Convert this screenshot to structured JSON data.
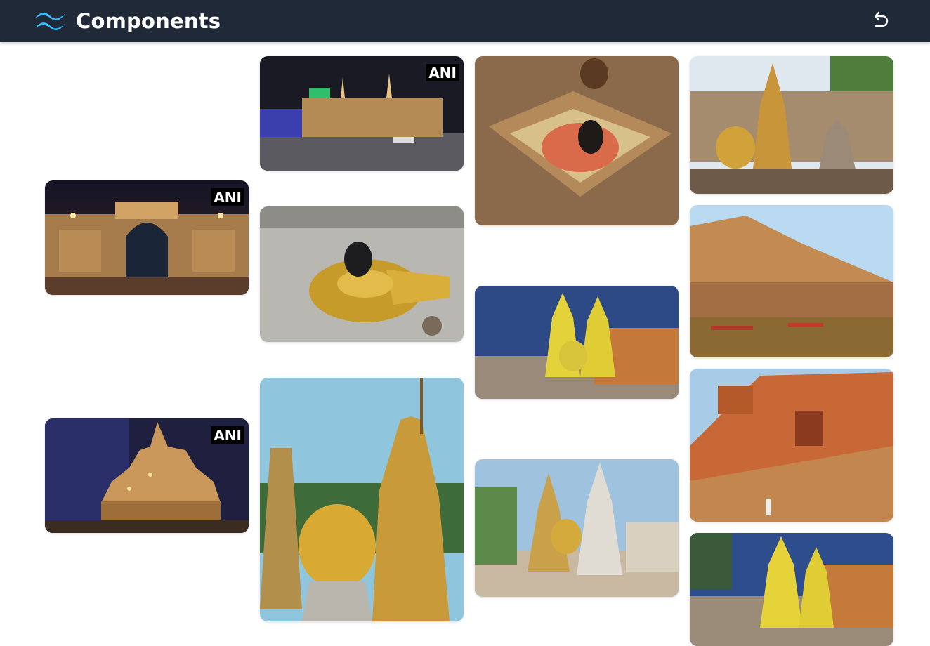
{
  "header": {
    "title": "Components",
    "logo_icon": "tailwind-wave-logo",
    "undo_icon": "undo-arrow-icon"
  },
  "colors": {
    "header_bg": "#1f2937",
    "logo_cyan": "#38bdf8",
    "title_text": "#ffffff"
  },
  "gallery": {
    "watermark": "ANI",
    "tiles": [
      {
        "subject": "illuminated-gate-night",
        "watermark": true
      },
      {
        "subject": "temple-model-night",
        "watermark": true
      },
      {
        "subject": "temple-complex-aerial-night",
        "watermark": true
      },
      {
        "subject": "shivling-gold-base",
        "watermark": false
      },
      {
        "subject": "golden-spires-closeup",
        "watermark": false
      },
      {
        "subject": "shivling-flower-offering",
        "watermark": false
      },
      {
        "subject": "temple-spires-dusk-lit",
        "watermark": false
      },
      {
        "subject": "temple-spires-daytime",
        "watermark": false
      },
      {
        "subject": "golden-spire-rooftops",
        "watermark": false
      },
      {
        "subject": "ghats-riverfront-boats",
        "watermark": false
      },
      {
        "subject": "red-fort-ghat-steps",
        "watermark": false
      },
      {
        "subject": "temple-spires-dusk-lit-2",
        "watermark": false
      }
    ]
  }
}
